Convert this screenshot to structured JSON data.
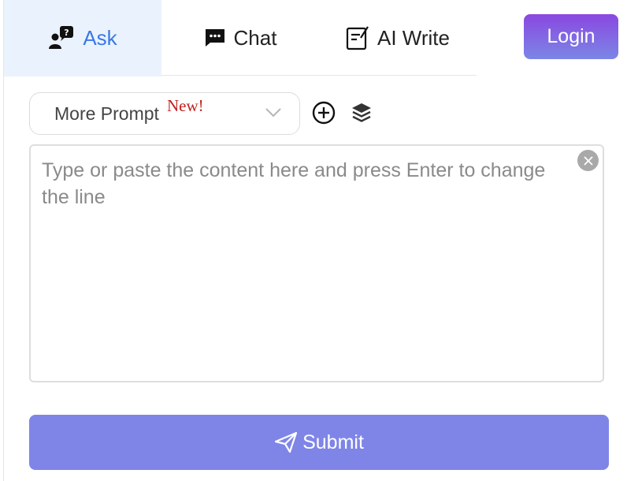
{
  "tabs": [
    {
      "label": "Ask",
      "icon": "ask-question-icon",
      "active": true
    },
    {
      "label": "Chat",
      "icon": "chat-bubble-icon",
      "active": false
    },
    {
      "label": "AI Write",
      "icon": "write-icon",
      "active": false
    }
  ],
  "header": {
    "login_label": "Login"
  },
  "prompt": {
    "selector_label": "More Prompt",
    "badge": "New!",
    "add_icon": "plus-circle-icon",
    "layers_icon": "layers-icon"
  },
  "editor": {
    "value": "",
    "placeholder": "Type or paste the content here and press Enter to change the line",
    "clear_icon": "clear-icon"
  },
  "submit": {
    "label": "Submit",
    "icon": "send-icon"
  },
  "colors": {
    "accent": "#3b78e7",
    "active_tab_bg": "#eaf3fd",
    "login_gradient_top": "#8a48e0",
    "login_gradient_bottom": "#7b86e6",
    "submit_bg": "#7f85e7",
    "badge": "#c0201f"
  }
}
